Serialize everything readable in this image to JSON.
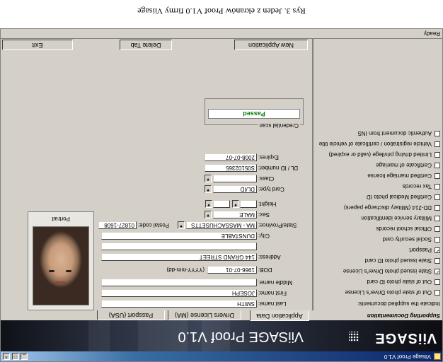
{
  "caption": "Rys 3. Jeden z ekranów Proof V1.0 firmy Viisage",
  "window": {
    "title": "Viisage Proof V1.0",
    "controls": {
      "minimize": "_",
      "maximize": "□",
      "close": "×"
    }
  },
  "banner": {
    "logo": "ViiSAGE",
    "product": "ViiSAGE Proof V1.0"
  },
  "tabs": {
    "supporting_documentation": "Supporting Documentation",
    "items": [
      {
        "label": "Application Data",
        "active": true
      },
      {
        "label": "Drivers License (MA)",
        "active": false
      },
      {
        "label": "Passport (USA)",
        "active": false
      }
    ]
  },
  "documents": {
    "title": "Indicate the supplied documents:",
    "items": [
      {
        "label": "Out of state photo Driver's License",
        "checked": false
      },
      {
        "label": "Out of state photo ID card",
        "checked": false
      },
      {
        "label": "State issued photo Driver's License",
        "checked": true
      },
      {
        "label": "State issued photo ID card",
        "checked": false
      },
      {
        "label": "Passport",
        "checked": true
      },
      {
        "label": "Social security card",
        "checked": false
      },
      {
        "label": "Official school records",
        "checked": false
      },
      {
        "label": "Military service identification",
        "checked": false
      },
      {
        "label": "DD-214 (Military discharge papers)",
        "checked": false
      },
      {
        "label": "Certified Medical photo ID",
        "checked": false
      },
      {
        "label": "Tax records",
        "checked": false
      },
      {
        "label": "Certified marriage license",
        "checked": false
      },
      {
        "label": "Certificate of marriage",
        "checked": false
      },
      {
        "label": "Limited driving privilege (valid or expired)",
        "checked": false
      },
      {
        "label": "Vehicle registration / certificate of vehicle title",
        "checked": false
      },
      {
        "label": "Authentic document from INS",
        "checked": false
      }
    ]
  },
  "form": {
    "last_name": {
      "label": "Last name:",
      "value": "SMITH"
    },
    "first_name": {
      "label": "First name:",
      "value": "JOSEPH"
    },
    "middle_name": {
      "label": "Middle name:",
      "value": ""
    },
    "dob": {
      "label": "DOB:",
      "value": "1966-07-01",
      "hint": "(YYYY-mm-dd)"
    },
    "address": {
      "label": "Address:",
      "value": "144 GRAND STREET"
    },
    "address2": {
      "value": ""
    },
    "city": {
      "label": "City:",
      "value": "DUNSTABLE"
    },
    "state": {
      "label": "State/Province:",
      "value": "MA - MASSACHUSETTS"
    },
    "postal": {
      "label": "Postal code:",
      "value": "01827-1608"
    },
    "sex": {
      "label": "Sex:",
      "value": "MALE"
    },
    "height": {
      "label": "Height:",
      "feet": "",
      "inches": ""
    },
    "card_type": {
      "label": "Card type:",
      "value": "DL/ID"
    },
    "class": {
      "label": "Class:",
      "value": ""
    },
    "dl_id_number": {
      "label": "DL / ID number:",
      "value": "S05102365"
    },
    "expires": {
      "label": "Expires:",
      "value": "2008-07-07"
    }
  },
  "portrait": {
    "label": "Portrait"
  },
  "credential": {
    "caption": "Credential scan",
    "result": "Passed",
    "result_color": "#0a7a0a"
  },
  "buttons": {
    "new_application": "New Application",
    "delete_tab": "Delete Tab",
    "exit": "Exit"
  },
  "status": "Ready"
}
